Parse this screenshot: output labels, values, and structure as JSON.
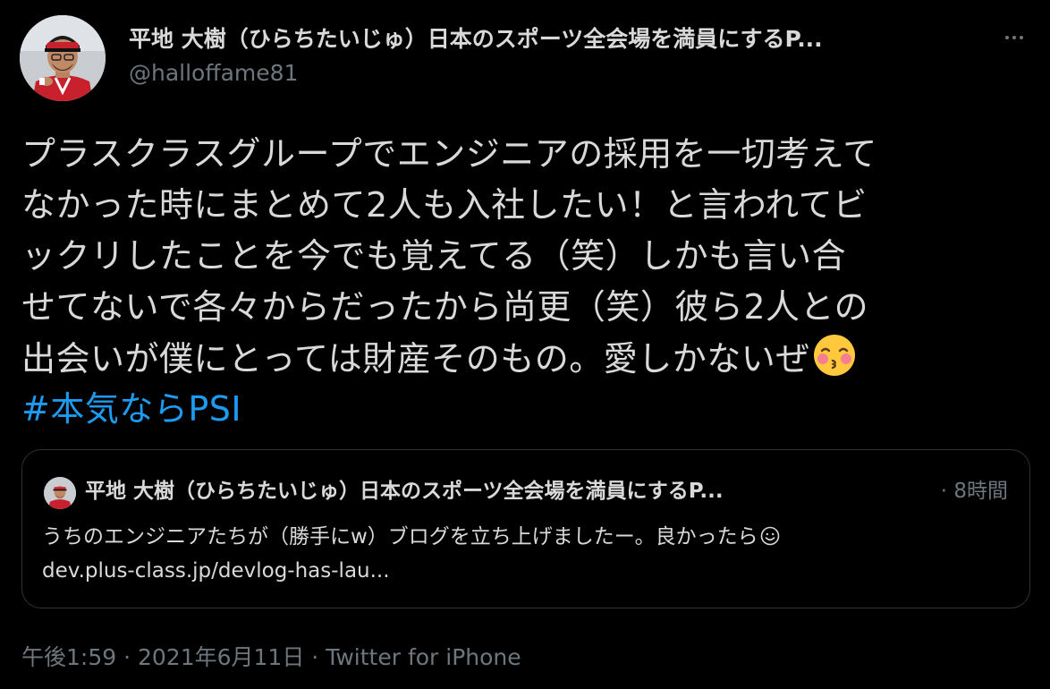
{
  "author": {
    "name": "平地 大樹（ひらちたいじゅ）日本のスポーツ全会場を満員にするP...",
    "handle": "@halloffame81"
  },
  "more_icon": "more-horizontal-icon",
  "tweet": {
    "lines": [
      "プラスクラスグループでエンジニアの採用を一切考えて",
      "なかった時にまとめて2人も入社したい！と言われてビ",
      "ックリしたことを今でも覚えてる（笑）しかも言い合",
      "せてないで各々からだったから尚更（笑）彼ら2人との",
      "出会いが僕にとっては財産そのもの。愛しかないぜ"
    ],
    "emoji": "kissing-face-with-closed-eyes-icon",
    "hashtag": "#本気ならPSI"
  },
  "quote": {
    "author_name": "平地 大樹（ひらちたいじゅ）日本のスポーツ全会場を満員にするP...",
    "time": "· 8時間",
    "text_line1": "うちのエンジニアたちが（勝手にw）ブログを立ち上げましたー。良かったら",
    "emoji": "smiling-face-icon",
    "link": "dev.plus-class.jp/devlog-has-lau..."
  },
  "meta": {
    "time": "午後1:59",
    "separator": "·",
    "date": "2021年6月11日",
    "source": "Twitter for iPhone"
  },
  "colors": {
    "background": "#000000",
    "text": "#d9d9d9",
    "muted": "#6e767d",
    "link": "#1d9bf0",
    "border": "#2f3336"
  }
}
